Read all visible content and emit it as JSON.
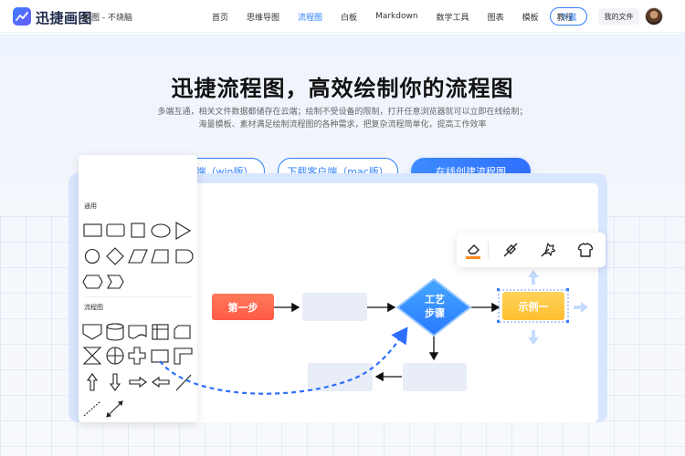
{
  "brand": {
    "name": "迅捷画图",
    "tagline": "脑图 - 不烧脑"
  },
  "nav": {
    "items": [
      {
        "label": "首页",
        "active": false
      },
      {
        "label": "思维导图",
        "active": false
      },
      {
        "label": "流程图",
        "active": true
      },
      {
        "label": "白板",
        "active": false
      },
      {
        "label": "Markdown",
        "active": false
      },
      {
        "label": "数学工具",
        "active": false
      },
      {
        "label": "图表",
        "active": false
      },
      {
        "label": "模板",
        "active": false
      },
      {
        "label": "教程",
        "active": false
      }
    ],
    "download_label": "下载",
    "my_files_label": "我的文件",
    "accent_color": "#2f80ff"
  },
  "hero": {
    "title": "迅捷流程图，高效绘制你的流程图",
    "subtitle_line1": "多端互通，相关文件数据都储存在云端；绘制不受设备的限制，打开任意浏览器就可以立即在线绘制；",
    "subtitle_line2": "海量模板、素材满足绘制流程图的各种需求，把复杂流程简单化，提高工作效率",
    "cta_win": "下载客户端（win版）",
    "cta_mac": "下载客户端（mac版）",
    "cta_online": "在线创建流程图"
  },
  "shape_panel": {
    "section_general": "通用",
    "section_flowchart": "流程图"
  },
  "toolbar": {
    "icons": [
      "fill-color-icon",
      "line-style-icon",
      "magic-wand-icon",
      "shirt-style-icon"
    ]
  },
  "flow": {
    "step1": "第一步",
    "process_line1": "工艺",
    "process_line2": "步骤",
    "example": "示例一"
  }
}
